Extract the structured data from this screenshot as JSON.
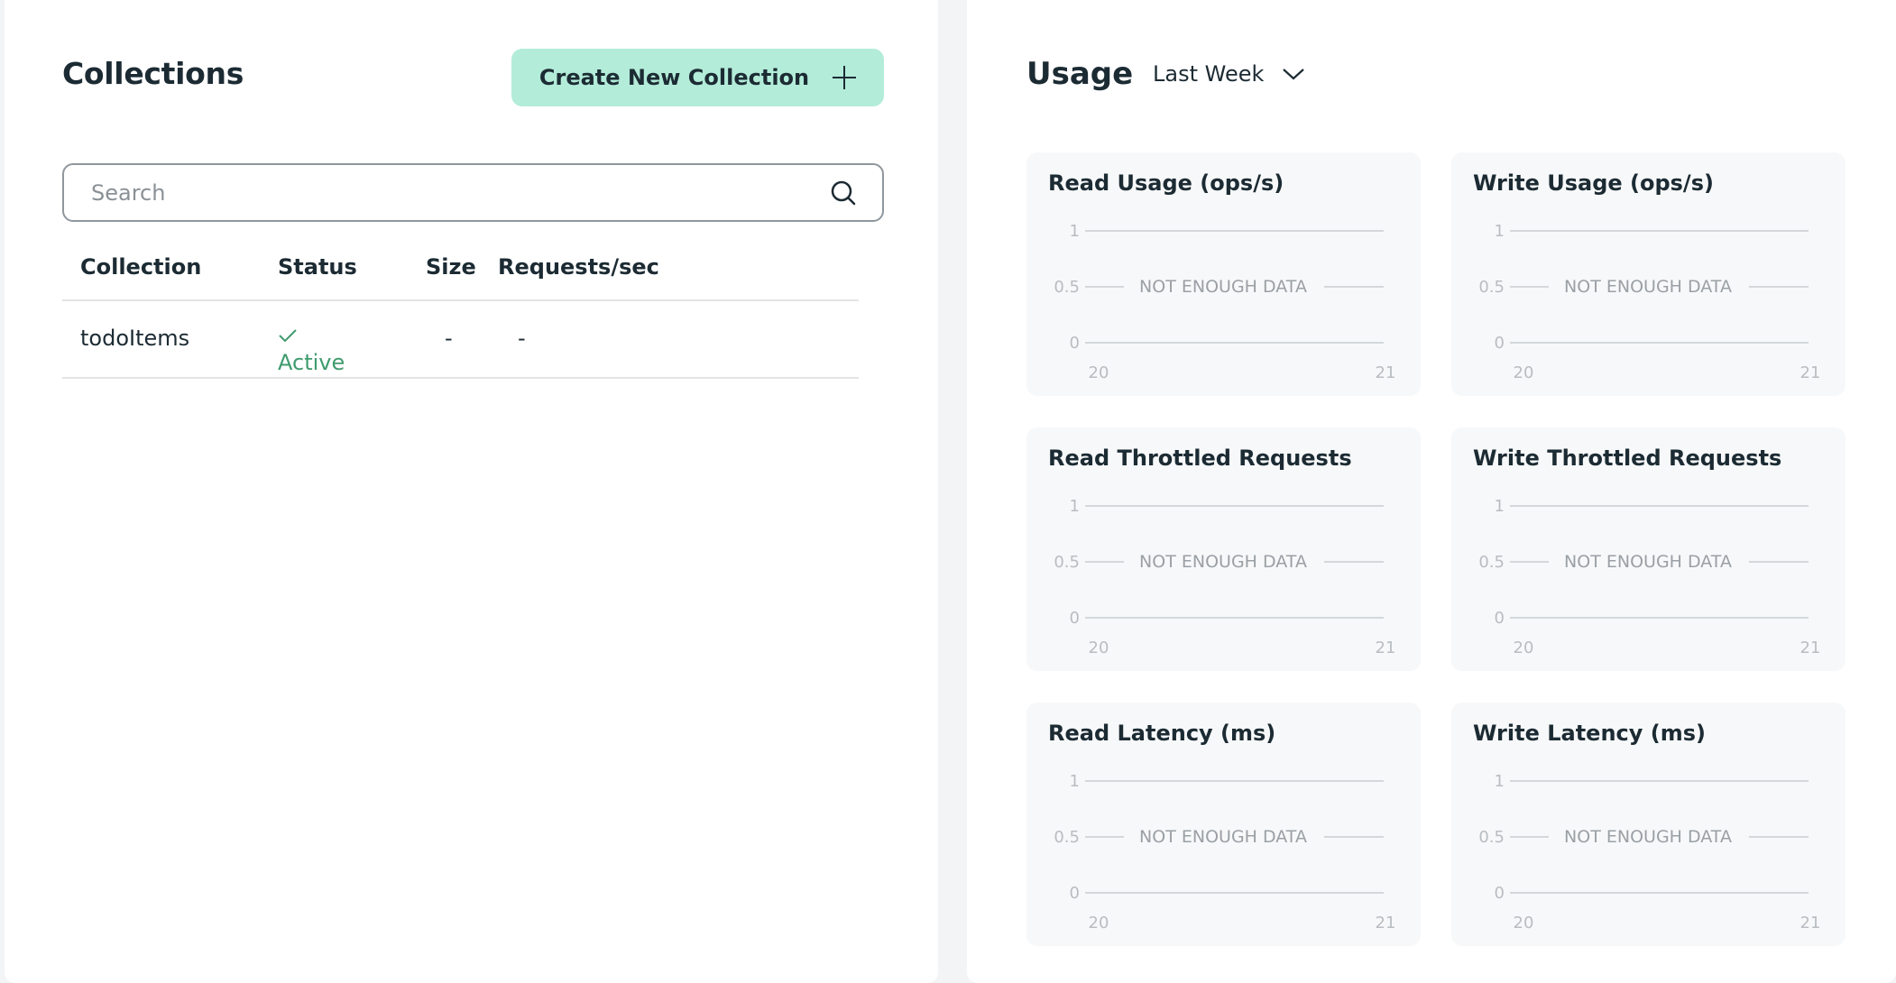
{
  "collections": {
    "title": "Collections",
    "create_button_label": "Create New Collection",
    "search_placeholder": "Search",
    "columns": [
      "Collection",
      "Status",
      "Size",
      "Requests/sec"
    ],
    "rows": [
      {
        "name": "todoItems",
        "status": "Active",
        "size": "-",
        "requests": "-"
      }
    ]
  },
  "usage": {
    "title": "Usage",
    "range": "Last Week",
    "empty_message": "NOT ENOUGH DATA",
    "y_ticks": [
      "1",
      "0.5",
      "0"
    ],
    "x_ticks": [
      "20",
      "21"
    ],
    "charts": [
      "Read Usage (ops/s)",
      "Write Usage (ops/s)",
      "Read Throttled Requests",
      "Write Throttled Requests",
      "Read Latency (ms)",
      "Write Latency (ms)"
    ]
  },
  "colors": {
    "accent": "#b3ecd9",
    "status_active": "#3f9b6e",
    "text_primary": "#1c2b33"
  }
}
